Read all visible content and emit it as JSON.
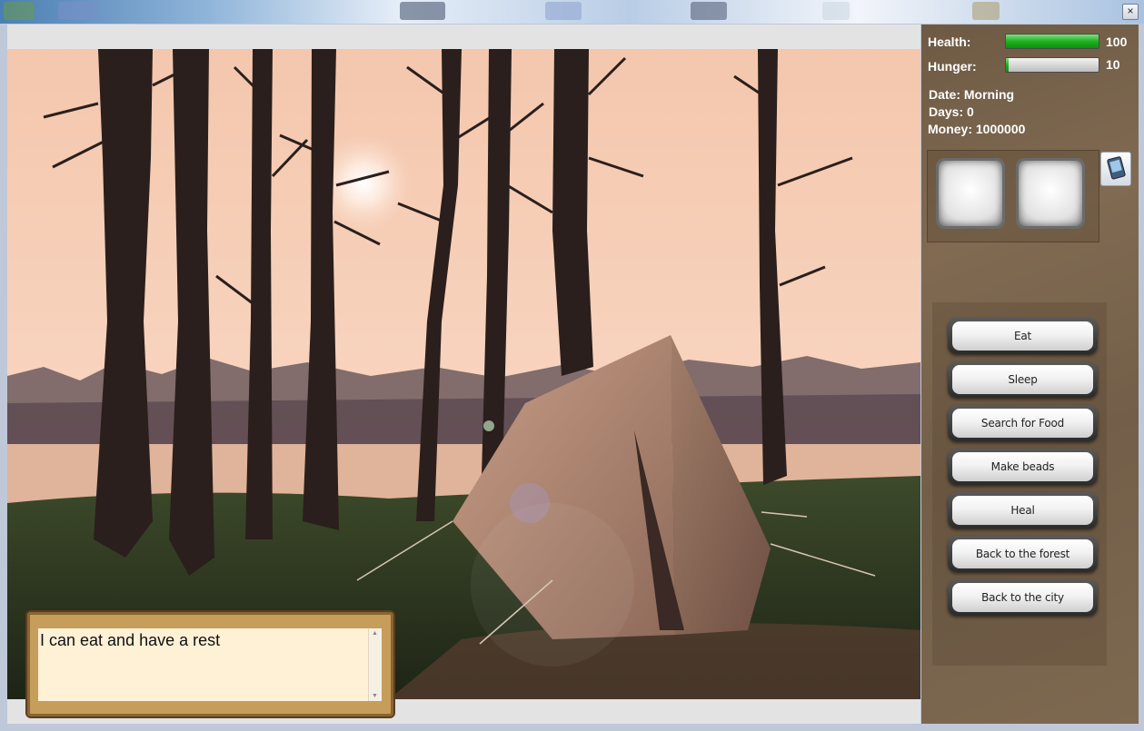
{
  "window": {
    "close_glyph": "×"
  },
  "stats": {
    "health_label": "Health:",
    "health_value": "100",
    "health_fraction": 1.0,
    "hunger_label": "Hunger:",
    "hunger_value": "10",
    "hunger_fraction": 0.03,
    "date_text": "Date: Morning",
    "days_text": "Days: 0",
    "money_text": "Money: 1000000"
  },
  "inventory": {
    "slots": 2,
    "phone_icon": "pda-icon"
  },
  "actions": [
    {
      "label": "Eat"
    },
    {
      "label": "Sleep"
    },
    {
      "label": "Search for Food"
    },
    {
      "label": "Make beads"
    },
    {
      "label": "Heal"
    },
    {
      "label": "Back to the forest"
    },
    {
      "label": "Back to the city"
    }
  ],
  "message": {
    "text": "I can eat and have a rest"
  },
  "colors": {
    "bar_green": "#1fb21f",
    "panel_brown": "#7a654d",
    "message_bg": "#fff1d6"
  }
}
